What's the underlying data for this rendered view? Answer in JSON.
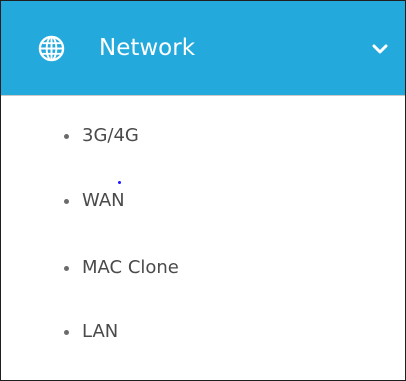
{
  "header": {
    "title": "Network",
    "icon": "globe-icon",
    "toggle_icon": "chevron-down-icon",
    "background_color": "#23a9dc",
    "text_color": "#ffffff"
  },
  "menu": {
    "items": [
      {
        "label": "3G/4G"
      },
      {
        "label": "WAN"
      },
      {
        "label": "MAC Clone"
      },
      {
        "label": "LAN"
      }
    ]
  }
}
